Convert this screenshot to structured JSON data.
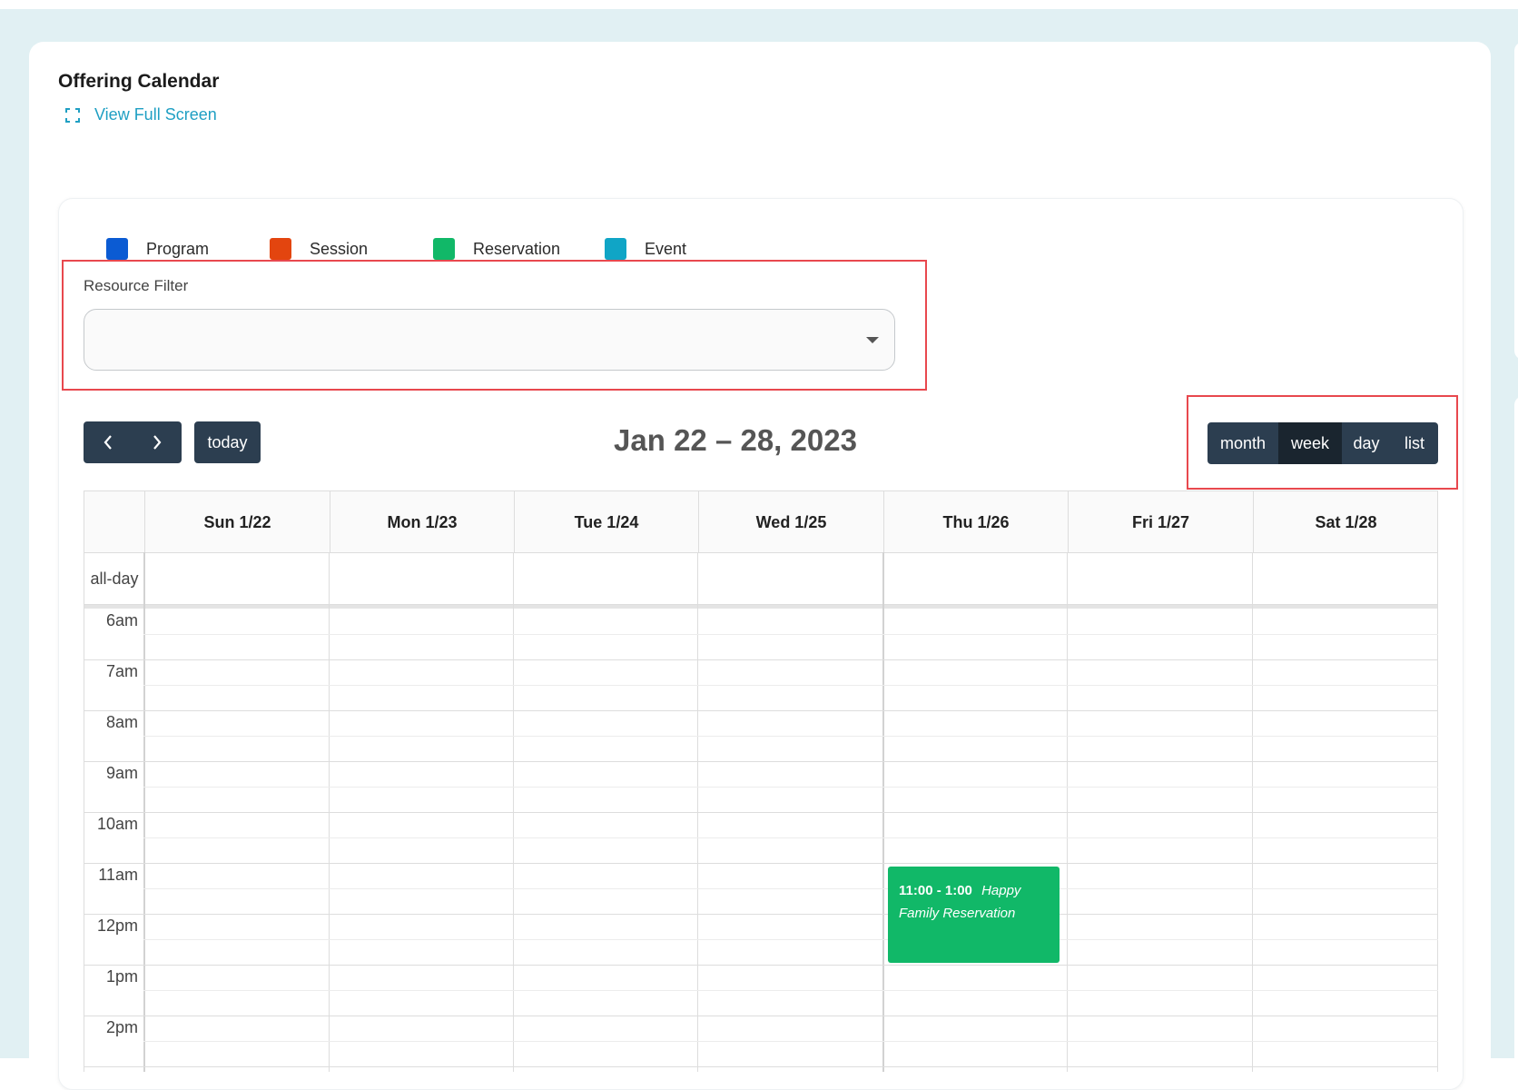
{
  "header": {
    "title": "Offering Calendar",
    "fullscreen_label": "View Full Screen"
  },
  "legend": [
    {
      "label": "Program",
      "color": "#0b5bd3"
    },
    {
      "label": "Session",
      "color": "#e3450f"
    },
    {
      "label": "Reservation",
      "color": "#11b868"
    },
    {
      "label": "Event",
      "color": "#10a5c6"
    }
  ],
  "filter": {
    "label": "Resource Filter",
    "value": ""
  },
  "toolbar": {
    "prev_icon": "chevron-left-icon",
    "next_icon": "chevron-right-icon",
    "today_label": "today",
    "range_title": "Jan 22 – 28, 2023",
    "views": [
      {
        "label": "month",
        "active": false
      },
      {
        "label": "week",
        "active": true
      },
      {
        "label": "day",
        "active": false
      },
      {
        "label": "list",
        "active": false
      }
    ]
  },
  "calendar": {
    "days": [
      "Sun 1/22",
      "Mon 1/23",
      "Tue 1/24",
      "Wed 1/25",
      "Thu 1/26",
      "Fri 1/27",
      "Sat 1/28"
    ],
    "allday_label": "all-day",
    "times": [
      "6am",
      "7am",
      "8am",
      "9am",
      "10am",
      "11am",
      "12pm",
      "1pm",
      "2pm"
    ],
    "events": [
      {
        "day": "Thu 1/26",
        "time": "11:00 - 1:00",
        "title": "Happy Family Reservation",
        "type": "Reservation",
        "color": "#11b868"
      }
    ]
  },
  "colors": {
    "accent": "#1f9fc3",
    "button": "#2c3e50",
    "button_active": "#1a252f",
    "highlight": "#e8484e",
    "background": "#e1f0f3"
  }
}
